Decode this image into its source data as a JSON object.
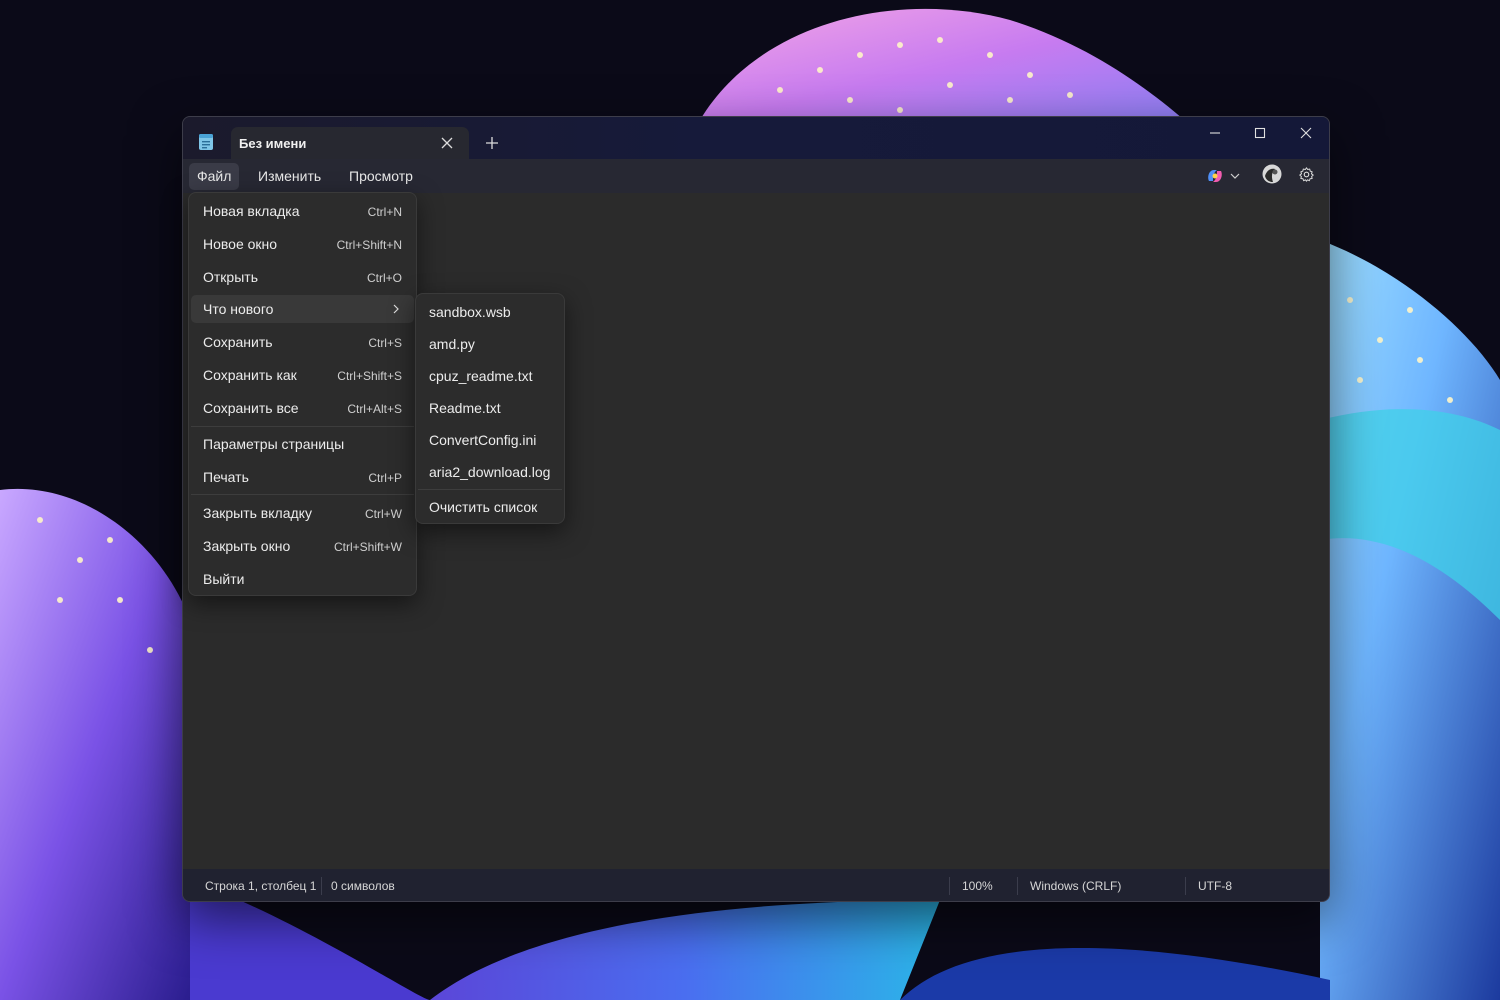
{
  "window": {
    "tab_title": "Без имени"
  },
  "menubar": {
    "file": "Файл",
    "edit": "Изменить",
    "view": "Просмотр"
  },
  "file_menu": {
    "items": [
      {
        "label": "Новая вкладка",
        "shortcut": "Ctrl+N"
      },
      {
        "label": "Новое окно",
        "shortcut": "Ctrl+Shift+N"
      },
      {
        "label": "Открыть",
        "shortcut": "Ctrl+O"
      },
      {
        "label": "Что нового",
        "shortcut": ""
      },
      {
        "label": "Сохранить",
        "shortcut": "Ctrl+S"
      },
      {
        "label": "Сохранить как",
        "shortcut": "Ctrl+Shift+S"
      },
      {
        "label": "Сохранить все",
        "shortcut": "Ctrl+Alt+S"
      },
      {
        "label": "Параметры страницы",
        "shortcut": ""
      },
      {
        "label": "Печать",
        "shortcut": "Ctrl+P"
      },
      {
        "label": "Закрыть вкладку",
        "shortcut": "Ctrl+W"
      },
      {
        "label": "Закрыть окно",
        "shortcut": "Ctrl+Shift+W"
      },
      {
        "label": "Выйти",
        "shortcut": ""
      }
    ]
  },
  "recent_menu": {
    "files": [
      "sandbox.wsb",
      "amd.py",
      "cpuz_readme.txt",
      "Readme.txt",
      "ConvertConfig.ini",
      "aria2_download.log"
    ],
    "clear_label": "Очистить список"
  },
  "statusbar": {
    "position": "Строка 1, столбец 1",
    "chars": "0 символов",
    "zoom": "100%",
    "line_ending": "Windows (CRLF)",
    "encoding": "UTF-8"
  },
  "icons": {
    "app": "notepad-icon",
    "tab_close": "close-icon",
    "new_tab": "plus-icon",
    "minimize": "minimize-icon",
    "maximize": "maximize-icon",
    "close": "close-icon",
    "copilot": "copilot-icon",
    "account": "avatar",
    "settings": "gear-icon"
  },
  "colors": {
    "window_bg": "#2b2b2b",
    "menu_bg": "#2c2c2c",
    "highlight": "#393939",
    "text": "#ececec"
  }
}
